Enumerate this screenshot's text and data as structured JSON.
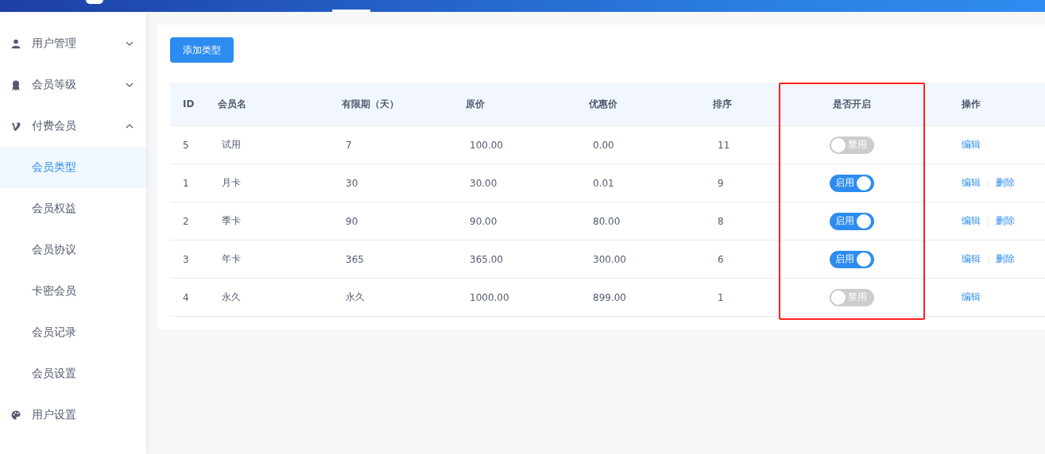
{
  "sidebar": {
    "items": [
      {
        "label": "用户管理",
        "expanded": false
      },
      {
        "label": "会员等级",
        "expanded": false
      },
      {
        "label": "付费会员",
        "expanded": true,
        "children": [
          {
            "label": "会员类型",
            "selected": true
          },
          {
            "label": "会员权益",
            "selected": false
          },
          {
            "label": "会员协议",
            "selected": false
          },
          {
            "label": "卡密会员",
            "selected": false
          },
          {
            "label": "会员记录",
            "selected": false
          },
          {
            "label": "会员设置",
            "selected": false
          }
        ]
      },
      {
        "label": "用户设置"
      }
    ]
  },
  "add_button": "添加类型",
  "table": {
    "columns": [
      {
        "label": "ID",
        "highlighted": false
      },
      {
        "label": "会员名",
        "highlighted": false
      },
      {
        "label": "有限期（天）",
        "highlighted": false
      },
      {
        "label": "原价",
        "highlighted": false
      },
      {
        "label": "优惠价",
        "highlighted": false
      },
      {
        "label": "排序",
        "highlighted": false
      },
      {
        "label": "是否开启",
        "highlighted": true
      },
      {
        "label": "操作",
        "highlighted": false
      }
    ],
    "rows": [
      {
        "id": "5",
        "name": "试用",
        "days": "7",
        "price": "100.00",
        "discount": "0.00",
        "sort": "11",
        "enabled": false,
        "switch_label": "禁用",
        "actions": [
          "编辑"
        ]
      },
      {
        "id": "1",
        "name": "月卡",
        "days": "30",
        "price": "30.00",
        "discount": "0.01",
        "sort": "9",
        "enabled": true,
        "switch_label": "启用",
        "actions": [
          "编辑",
          "删除"
        ]
      },
      {
        "id": "2",
        "name": "季卡",
        "days": "90",
        "price": "90.00",
        "discount": "80.00",
        "sort": "8",
        "enabled": true,
        "switch_label": "启用",
        "actions": [
          "编辑",
          "删除"
        ]
      },
      {
        "id": "3",
        "name": "年卡",
        "days": "365",
        "price": "365.00",
        "discount": "300.00",
        "sort": "6",
        "enabled": true,
        "switch_label": "启用",
        "actions": [
          "编辑",
          "删除"
        ]
      },
      {
        "id": "4",
        "name": "永久",
        "days": "永久",
        "price": "1000.00",
        "discount": "899.00",
        "sort": "1",
        "enabled": false,
        "switch_label": "禁用",
        "actions": [
          "编辑"
        ]
      }
    ]
  }
}
